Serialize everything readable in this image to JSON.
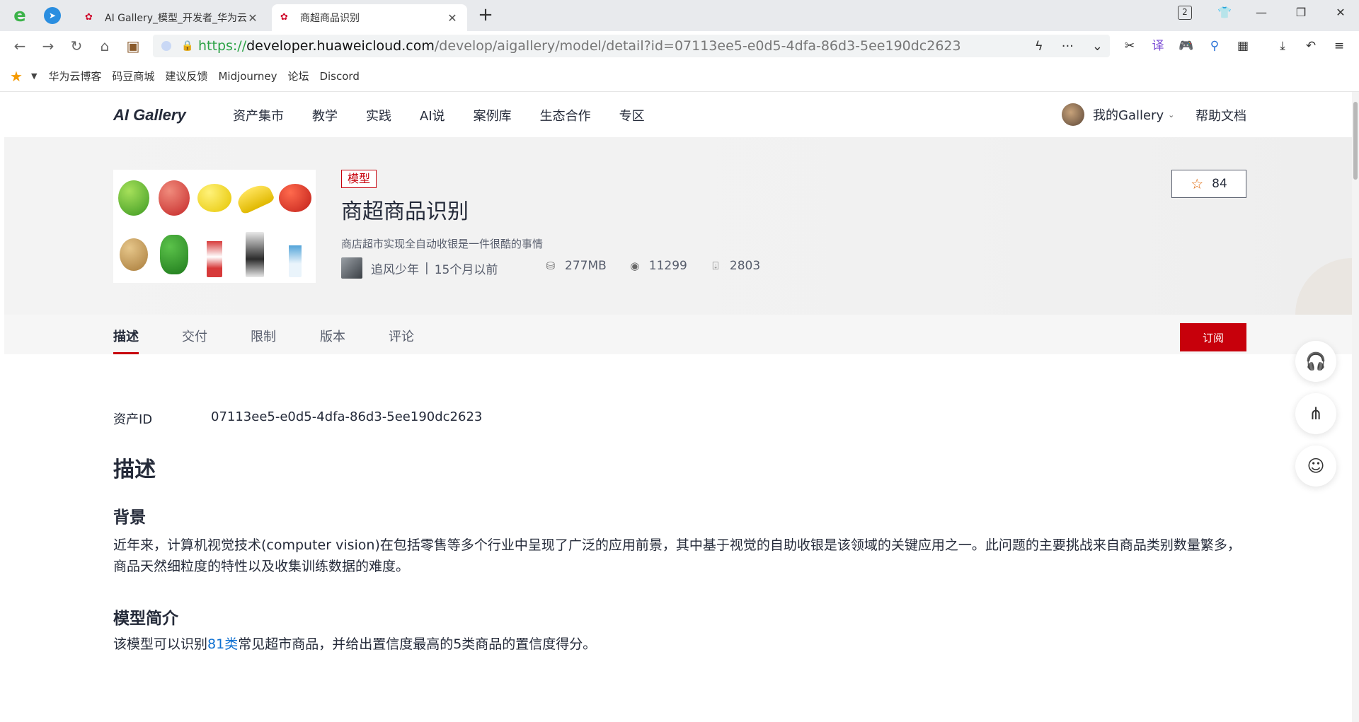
{
  "browser": {
    "tabs": [
      {
        "title": "AI Gallery_模型_开发者_华为云",
        "active": false
      },
      {
        "title": "商超商品识别",
        "active": true
      }
    ],
    "url_scheme": "https://",
    "url_host": "developer.huaweicloud.com",
    "url_path": "/develop/aigallery/model/detail?id=07113ee5-e0d5-4dfa-86d3-5ee190dc2623",
    "tab_count": "2",
    "bookmarks": [
      "华为云博客",
      "码豆商城",
      "建议反馈",
      "Midjourney",
      "论坛",
      "Discord"
    ]
  },
  "site": {
    "brand": "AI Gallery",
    "menu": [
      "资产集市",
      "教学",
      "实践",
      "AI说",
      "案例库",
      "生态合作",
      "专区"
    ],
    "my_gallery": "我的Gallery",
    "help_docs": "帮助文档"
  },
  "asset": {
    "tag": "模型",
    "title": "商超商品识别",
    "description": "商店超市实现全自动收银是一件很酷的事情",
    "author": "追风少年",
    "time": "15个月以前",
    "size": "277MB",
    "views": "11299",
    "downloads": "2803",
    "stars": "84"
  },
  "tabs": [
    "描述",
    "交付",
    "限制",
    "版本",
    "评论"
  ],
  "subscribe_label": "订阅",
  "detail": {
    "asset_id_label": "资产ID",
    "asset_id": "07113ee5-e0d5-4dfa-86d3-5ee190dc2623",
    "heading": "描述",
    "background_heading": "背景",
    "background_text": "近年来，计算机视觉技术(computer vision)在包括零售等多个行业中呈现了广泛的应用前景，其中基于视觉的自助收银是该领域的关键应用之一。此问题的主要挑战来自商品类别数量繁多，商品天然细粒度的特性以及收集训练数据的难度。",
    "intro_heading": "模型简介",
    "intro_prefix": "该模型可以识别",
    "intro_link": "81类",
    "intro_suffix": "常见超市商品，并给出置信度最高的5类商品的置信度得分。"
  },
  "icons": {
    "star": "star-outline-icon",
    "size": "database-icon",
    "views": "eye-icon",
    "downloads": "download-box-icon"
  },
  "colors": {
    "brand_red": "#c7000b",
    "link_blue": "#0d6fd1",
    "url_green": "#2ba245"
  }
}
